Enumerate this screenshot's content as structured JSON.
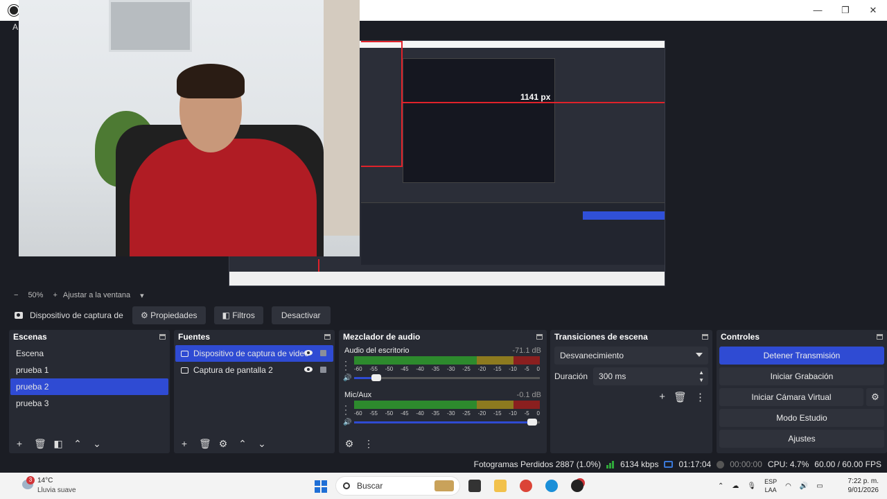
{
  "window": {
    "title": "",
    "controls": [
      "—",
      "❐",
      "✕"
    ]
  },
  "menubar": {
    "first_item": "A"
  },
  "preview": {
    "measure_label": "1141 px"
  },
  "zoombar": {
    "minus": "−",
    "zoom": "50%",
    "plus": "+",
    "fit": "Ajustar a la ventana",
    "dropdown": "▾"
  },
  "source_toolbar": {
    "source_name": "Dispositivo de captura de v",
    "properties": "Propiedades",
    "filters": "Filtros",
    "deactivate": "Desactivar"
  },
  "scenes": {
    "title": "Escenas",
    "items": [
      {
        "label": "Escena",
        "selected": false
      },
      {
        "label": "prueba 1",
        "selected": false
      },
      {
        "label": "prueba 2",
        "selected": true
      },
      {
        "label": "prueba 3",
        "selected": false
      }
    ],
    "footer_icons": [
      "add-icon",
      "trash-icon",
      "filter-icon",
      "arrow-up-icon",
      "arrow-down-icon"
    ]
  },
  "sources": {
    "title": "Fuentes",
    "items": [
      {
        "label": "Dispositivo de captura de video",
        "selected": true,
        "icon": "camera-icon"
      },
      {
        "label": "Captura de pantalla 2",
        "selected": false,
        "icon": "monitor-icon"
      }
    ],
    "footer_icons": [
      "add-icon",
      "trash-icon",
      "gear-icon",
      "arrow-up-icon",
      "arrow-down-icon"
    ]
  },
  "mixer": {
    "title": "Mezclador de audio",
    "ticks": [
      "-60",
      "-55",
      "-50",
      "-45",
      "-40",
      "-35",
      "-30",
      "-25",
      "-20",
      "-15",
      "-10",
      "-5",
      "0"
    ],
    "tracks": [
      {
        "name": "Audio del escritorio",
        "db": "-71.1 dB",
        "volume": 0.12
      },
      {
        "name": "Mic/Aux",
        "db": "-0.1 dB",
        "volume": 0.96
      }
    ]
  },
  "transitions": {
    "title": "Transiciones de escena",
    "selected": "Desvanecimiento",
    "duration_label": "Duración",
    "duration_value": "300 ms"
  },
  "controls": {
    "title": "Controles",
    "stop_stream": "Detener Transmisión",
    "start_recording": "Iniciar Grabación",
    "start_virtual_cam": "Iniciar Cámara Virtual",
    "studio_mode": "Modo Estudio",
    "settings": "Ajustes"
  },
  "status": {
    "dropped_frames": "Fotogramas Perdidos 2887 (1.0%)",
    "bitrate": "6134 kbps",
    "stream_time": "01:17:04",
    "rec_time": "00:00:00",
    "cpu": "CPU: 4.7%",
    "fps": "60.00 / 60.00 FPS"
  },
  "taskbar": {
    "weather_badge": "3",
    "temperature": "14°C",
    "weather": "Lluvia suave",
    "search": "Buscar",
    "lang_top": "ESP",
    "lang_bottom": "LAA",
    "time": "7:22 p. m.",
    "date": "9/01/2026"
  }
}
